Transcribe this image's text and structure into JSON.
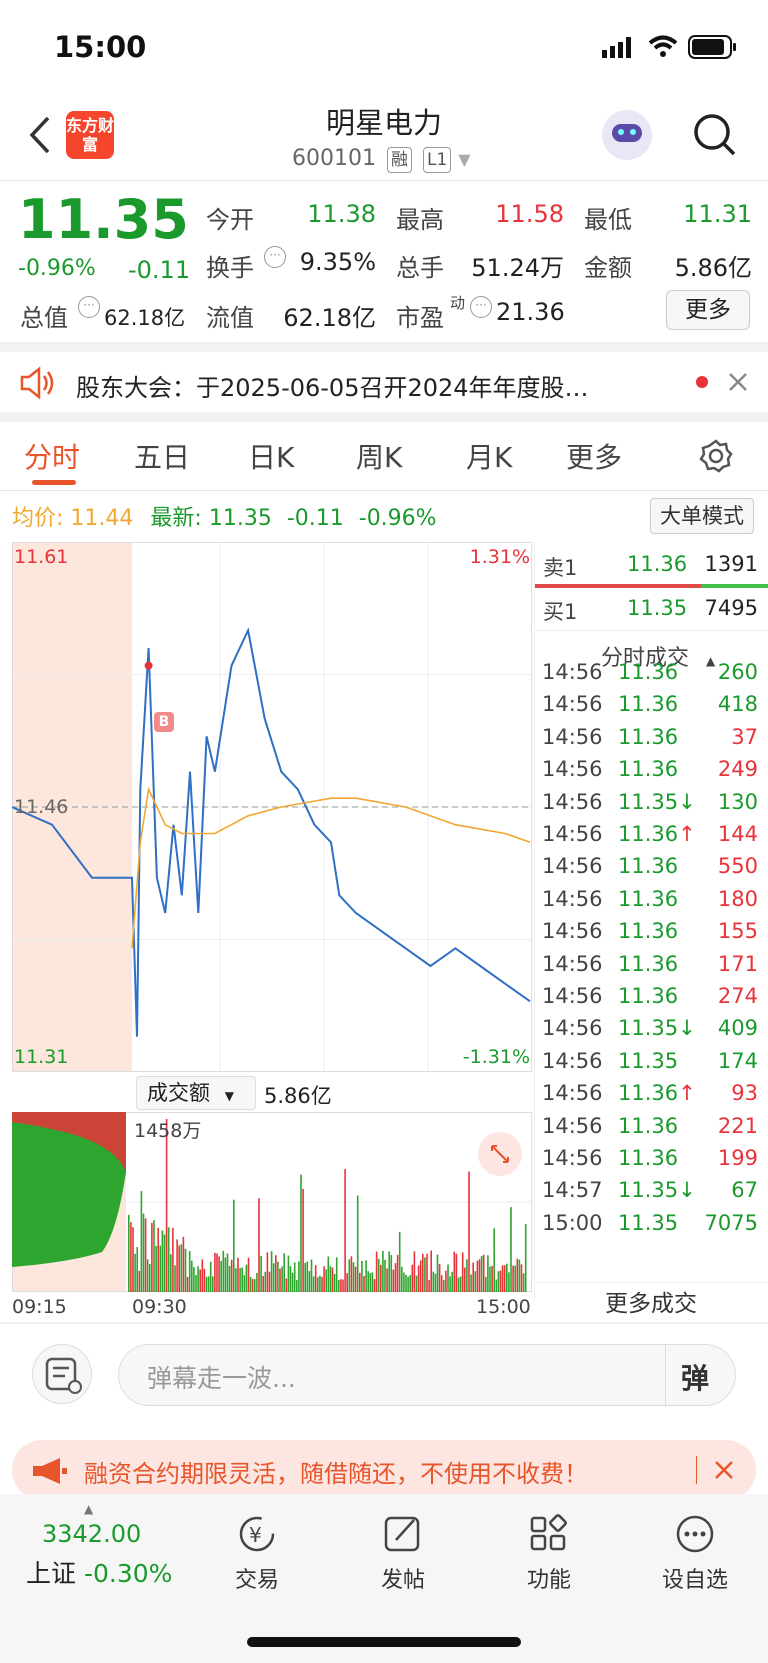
{
  "status_bar": {
    "time": "15:00"
  },
  "header": {
    "logo_text": "东方财富",
    "title": "明星电力",
    "code": "600101",
    "tag_margin": "融",
    "tag_level": "L1"
  },
  "quote": {
    "price": "11.35",
    "change_pct": "-0.96%",
    "change": "-0.11",
    "open_label": "今开",
    "open": "11.38",
    "high_label": "最高",
    "high": "11.58",
    "low_label": "最低",
    "low": "11.31",
    "turnover_label": "换手",
    "turnover": "9.35%",
    "volume_label": "总手",
    "volume": "51.24万",
    "amount_label": "金额",
    "amount": "5.86亿",
    "mktcap_label": "总值",
    "mktcap": "62.18亿",
    "float_label": "流值",
    "float": "62.18亿",
    "pe_label": "市盈",
    "pe_sup": "动",
    "pe": "21.36",
    "more_button": "更多"
  },
  "notice": {
    "text": "股东大会：于2025-06-05召开2024年年度股…"
  },
  "tabs": [
    "分时",
    "五日",
    "日K",
    "周K",
    "月K",
    "更多"
  ],
  "info_bar": {
    "avg_label": "均价:",
    "avg": "11.44",
    "latest_label": "最新:",
    "latest": "11.35",
    "change": "-0.11",
    "change_pct": "-0.96%",
    "big_order_button": "大单模式"
  },
  "chart_data": {
    "type": "line",
    "title": "",
    "y_max_label": "11.61",
    "y_mid_label": "11.46",
    "y_min_label": "11.31",
    "pct_max_label": "1.31%",
    "pct_min_label": "-1.31%",
    "ylim": [
      11.31,
      11.61
    ],
    "series": [
      {
        "name": "",
        "color": "#2f6fc4",
        "x": [
          "09:15",
          "09:20",
          "09:25",
          "09:30",
          "09:33",
          "09:35",
          "09:40",
          "09:45",
          "09:50",
          "09:55",
          "10:00",
          "10:05",
          "10:10",
          "10:15",
          "10:20",
          "10:30",
          "10:40",
          "10:50",
          "11:00",
          "11:10",
          "11:20",
          "11:30",
          "13:05",
          "13:15",
          "13:30",
          "13:45",
          "14:00",
          "14:15",
          "14:30",
          "14:45",
          "15:00"
        ],
        "values": [
          11.46,
          11.45,
          11.42,
          11.42,
          11.33,
          11.47,
          11.55,
          11.42,
          11.4,
          11.45,
          11.41,
          11.48,
          11.4,
          11.5,
          11.48,
          11.54,
          11.56,
          11.51,
          11.48,
          11.47,
          11.45,
          11.44,
          11.41,
          11.4,
          11.39,
          11.38,
          11.37,
          11.38,
          11.37,
          11.36,
          11.35
        ]
      },
      {
        "name": "",
        "color": "#f0a830",
        "x": [
          "09:30",
          "09:35",
          "09:40",
          "09:45",
          "09:50",
          "10:00",
          "10:20",
          "10:40",
          "11:00",
          "11:30",
          "13:15",
          "13:45",
          "14:15",
          "14:45",
          "15:00"
        ],
        "values": [
          11.38,
          11.44,
          11.47,
          11.46,
          11.45,
          11.445,
          11.445,
          11.455,
          11.46,
          11.465,
          11.465,
          11.46,
          11.45,
          11.445,
          11.44
        ]
      }
    ],
    "volume_label": "成交额",
    "volume_total": "5.86亿",
    "volume_max_label": "1458万",
    "x_ticks": [
      "09:15",
      "09:30",
      "15:00"
    ]
  },
  "order_book": {
    "ask_label": "卖1",
    "ask_price": "11.36",
    "ask_vol": "1391",
    "bid_label": "买1",
    "bid_price": "11.35",
    "bid_vol": "7495"
  },
  "trades_header": "分时成交",
  "trades": [
    {
      "time": "14:56",
      "price": "11.36",
      "arrow": "",
      "vol": "260",
      "dir": "buy"
    },
    {
      "time": "14:56",
      "price": "11.36",
      "arrow": "",
      "vol": "418",
      "dir": "buy"
    },
    {
      "time": "14:56",
      "price": "11.36",
      "arrow": "",
      "vol": "37",
      "dir": "sell"
    },
    {
      "time": "14:56",
      "price": "11.36",
      "arrow": "",
      "vol": "249",
      "dir": "sell"
    },
    {
      "time": "14:56",
      "price": "11.35",
      "arrow": "↓",
      "vol": "130",
      "dir": "buy"
    },
    {
      "time": "14:56",
      "price": "11.36",
      "arrow": "↑",
      "vol": "144",
      "dir": "sell"
    },
    {
      "time": "14:56",
      "price": "11.36",
      "arrow": "",
      "vol": "550",
      "dir": "sell"
    },
    {
      "time": "14:56",
      "price": "11.36",
      "arrow": "",
      "vol": "180",
      "dir": "sell"
    },
    {
      "time": "14:56",
      "price": "11.36",
      "arrow": "",
      "vol": "155",
      "dir": "sell"
    },
    {
      "time": "14:56",
      "price": "11.36",
      "arrow": "",
      "vol": "171",
      "dir": "sell"
    },
    {
      "time": "14:56",
      "price": "11.36",
      "arrow": "",
      "vol": "274",
      "dir": "sell"
    },
    {
      "time": "14:56",
      "price": "11.35",
      "arrow": "↓",
      "vol": "409",
      "dir": "buy"
    },
    {
      "time": "14:56",
      "price": "11.35",
      "arrow": "",
      "vol": "174",
      "dir": "buy"
    },
    {
      "time": "14:56",
      "price": "11.36",
      "arrow": "↑",
      "vol": "93",
      "dir": "sell"
    },
    {
      "time": "14:56",
      "price": "11.36",
      "arrow": "",
      "vol": "221",
      "dir": "sell"
    },
    {
      "time": "14:56",
      "price": "11.36",
      "arrow": "",
      "vol": "199",
      "dir": "sell"
    },
    {
      "time": "14:57",
      "price": "11.35",
      "arrow": "↓",
      "vol": "67",
      "dir": "buy"
    },
    {
      "time": "15:00",
      "price": "11.35",
      "arrow": "",
      "vol": "7075",
      "dir": "buy"
    }
  ],
  "more_trades": "更多成交",
  "danmu": {
    "placeholder": "弹幕走一波...",
    "button": "弹"
  },
  "promo": {
    "text": "融资合约期限灵活，随借随还，不使用不收费！"
  },
  "bottom_bar": {
    "index_value": "3342.00",
    "index_name": "上证",
    "index_change": "-0.30%",
    "items": [
      "交易",
      "发帖",
      "功能",
      "设自选"
    ]
  },
  "colors": {
    "up": "#e8333a",
    "down": "#1a9a2c",
    "accent": "#e8552a",
    "price_line": "#2f6fc4",
    "avg_line": "#f0a830"
  }
}
